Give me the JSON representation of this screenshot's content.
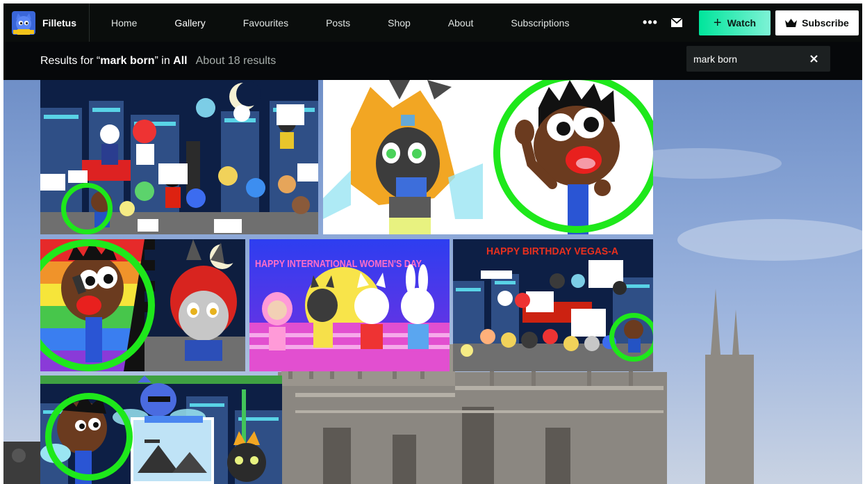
{
  "artist": {
    "name": "Filletus"
  },
  "nav": {
    "items": [
      {
        "label": "Home"
      },
      {
        "label": "Gallery"
      },
      {
        "label": "Favourites"
      },
      {
        "label": "Posts"
      },
      {
        "label": "Shop"
      },
      {
        "label": "About"
      },
      {
        "label": "Subscriptions"
      }
    ],
    "active": "Gallery",
    "more": "•••",
    "watch_label": "Watch",
    "subscribe_label": "Subscribe"
  },
  "results": {
    "prefix": "Results for “",
    "query": "mark born",
    "middle": "” in ",
    "scope": "All",
    "count_text": "About 18 results"
  },
  "search": {
    "value": "mark born"
  },
  "gallery": {
    "thumbs": [
      {
        "name": "birthday-party-city"
      },
      {
        "name": "mark-waving-portrait"
      },
      {
        "name": "rainbow-mark-cat"
      },
      {
        "text": "HAPPY INTERNATIONAL WOMEN'S DAY"
      },
      {
        "text": "HAPPY BIRTHDAY VEGAS-A"
      },
      {
        "name": "game-level-scene"
      }
    ]
  },
  "colors": {
    "highlight_ring": "#1ee81b",
    "watch_start": "#00e59b",
    "watch_end": "#7ef2d6"
  }
}
